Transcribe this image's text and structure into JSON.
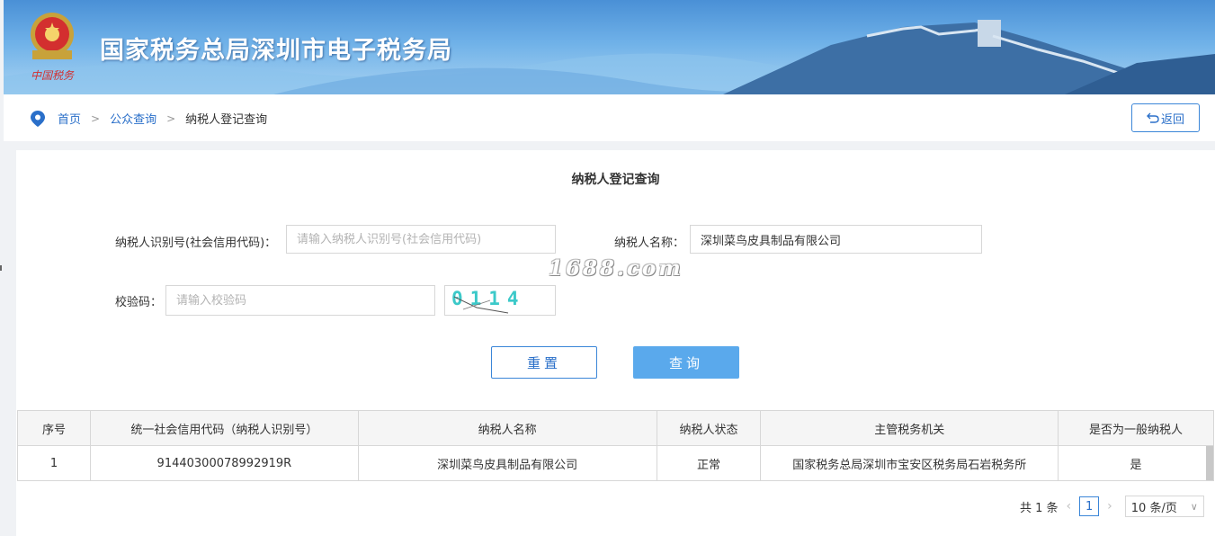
{
  "header": {
    "title": "国家税务总局深圳市电子税务局",
    "emblem_caption": "中国税务"
  },
  "breadcrumb": {
    "home": "首页",
    "sep": ">",
    "public_query": "公众查询",
    "current": "纳税人登记查询"
  },
  "back_button": "返回",
  "form": {
    "title": "纳税人登记查询",
    "taxpayer_id_label": "纳税人识别号(社会信用代码)：",
    "taxpayer_id_placeholder": "请输入纳税人识别号(社会信用代码)",
    "taxpayer_id_value": "",
    "taxpayer_name_label": "纳税人名称：",
    "taxpayer_name_value": "深圳菜鸟皮具制品有限公司",
    "captcha_label": "校验码：",
    "captcha_placeholder": "请输入校验码",
    "captcha_image_text": "0114",
    "reset_label": "重置",
    "query_label": "查询"
  },
  "watermark": "1688.com",
  "table": {
    "headers": [
      "序号",
      "统一社会信用代码（纳税人识别号）",
      "纳税人名称",
      "纳税人状态",
      "主管税务机关",
      "是否为一般纳税人"
    ],
    "rows": [
      [
        "1",
        "91440300078992919R",
        "深圳菜鸟皮具制品有限公司",
        "正常",
        "国家税务总局深圳市宝安区税务局石岩税务所",
        "是"
      ]
    ]
  },
  "pagination": {
    "total": "共 1 条",
    "current_page": "1",
    "page_size": "10 条/页"
  },
  "colors": {
    "accent": "#2a6fc9",
    "query_button": "#5aa9ec",
    "banner_top": "#4a90d6"
  }
}
